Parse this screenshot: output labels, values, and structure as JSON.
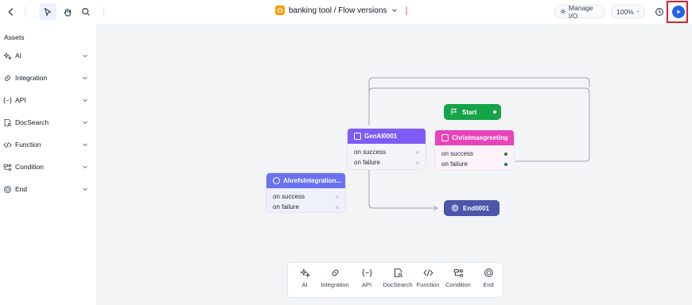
{
  "topbar": {
    "title": "banking tool / Flow versions",
    "manage_io": "Manage I/O",
    "zoom": "100%"
  },
  "sidebar": {
    "title": "Assets",
    "items": [
      {
        "label": "AI",
        "icon": "sparkle-icon"
      },
      {
        "label": "Integration",
        "icon": "link-icon"
      },
      {
        "label": "API",
        "icon": "api-braces-icon"
      },
      {
        "label": "DocSearch",
        "icon": "doc-search-icon"
      },
      {
        "label": "Function",
        "icon": "code-icon"
      },
      {
        "label": "Condition",
        "icon": "condition-icon"
      },
      {
        "label": "End",
        "icon": "end-circle-icon"
      }
    ]
  },
  "nodes": {
    "start": {
      "title": "Start",
      "color": "#16a34a"
    },
    "genai": {
      "title": "GenAI0001",
      "color": "#7c5cf5",
      "success": "on success",
      "failure": "on failure"
    },
    "christmas": {
      "title": "Christmasgreeting",
      "color": "#e844b8",
      "success": "on success",
      "failure": "on failure"
    },
    "ahrefs": {
      "title": "AhrefsIntegration...",
      "color": "#6b72f0",
      "success": "on success",
      "failure": "on failure"
    },
    "end": {
      "title": "End0001",
      "color": "#4b57a8"
    }
  },
  "palette": {
    "items": [
      {
        "label": "AI"
      },
      {
        "label": "Integration"
      },
      {
        "label": "API"
      },
      {
        "label": "DocSearch"
      },
      {
        "label": "Function"
      },
      {
        "label": "Condition"
      },
      {
        "label": "End"
      }
    ]
  }
}
